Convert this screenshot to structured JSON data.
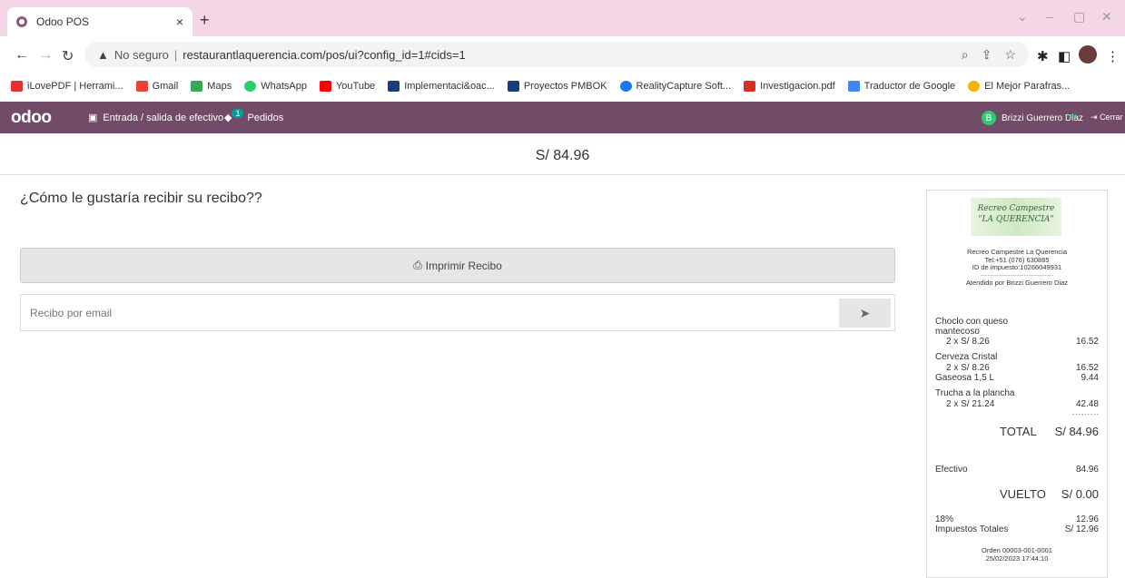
{
  "browser": {
    "tab_title": "Odoo POS",
    "tab_close": "×",
    "new_tab": "+",
    "address_security": "No seguro",
    "address_separator": "|",
    "address_url": "restaurantlaquerencia.com/pos/ui?config_id=1#cids=1",
    "bookmarks": [
      {
        "label": "iLovePDF | Herrami...",
        "color": "#e5322d"
      },
      {
        "label": "Gmail",
        "color": "#ea4335"
      },
      {
        "label": "Maps",
        "color": "#34a853"
      },
      {
        "label": "WhatsApp",
        "color": "#25d366"
      },
      {
        "label": "YouTube",
        "color": "#ff0000"
      },
      {
        "label": "Implementaci&oac...",
        "color": "#1a3e7a"
      },
      {
        "label": "Proyectos PMBOK",
        "color": "#1a3e7a"
      },
      {
        "label": "RealityCapture Soft...",
        "color": "#1877f2"
      },
      {
        "label": "Investigacion.pdf",
        "color": "#d93025"
      },
      {
        "label": "Traductor de Google",
        "color": "#4285f4"
      },
      {
        "label": "El Mejor Parafras...",
        "color": "#f4b400"
      }
    ]
  },
  "header": {
    "logo": "odoo",
    "cash_button": "Entrada / salida de efectivo",
    "orders_badge": "1",
    "orders_button": "Pedidos",
    "user_initial": "B",
    "user_name": "Brizzi Guerrero Diaz",
    "close_button": "Cerrar"
  },
  "amount": "S/ 84.96",
  "question": "¿Cómo le gustaría recibir su recibo??",
  "print_button": "Imprimir Recibo",
  "email_placeholder": "Recibo por email",
  "receipt": {
    "logo_line1": "Recreo Campestre",
    "logo_line2": "\"LA QUERENCIA\"",
    "company": "Recreo Campestre La Querencia",
    "phone": "Tel:+51 (076) 630885",
    "tax_id": "ID de impuesto:10266049931",
    "separator": "--------------------------------",
    "served_by": "Atendido por Brizzi Guerrero Diaz",
    "items": [
      {
        "name": "Choclo con queso",
        "name2": "mantecoso",
        "qty": "2 x S/ 8.26",
        "total": "16.52"
      },
      {
        "name": "Cerveza Cristal",
        "qty": "2 x S/ 8.26",
        "total": "16.52"
      },
      {
        "name": "Gaseosa 1,5 L",
        "total": "9.44"
      },
      {
        "name": "Trucha a la plancha",
        "qty": "2 x S/ 21.24",
        "total": "42.48"
      }
    ],
    "total_dashes": "---------",
    "total_label": "TOTAL",
    "total_value": "S/ 84.96",
    "cash_label": "Efectivo",
    "cash_value": "84.96",
    "change_label": "VUELTO",
    "change_value": "S/ 0.00",
    "tax_rate_label": "18%",
    "tax_rate_value": "12.96",
    "tax_total_label": "Impuestos Totales",
    "tax_total_value": "S/ 12.96",
    "order": "Orden 00003-001-0001",
    "datetime": "25/02/2023 17:44:10"
  }
}
